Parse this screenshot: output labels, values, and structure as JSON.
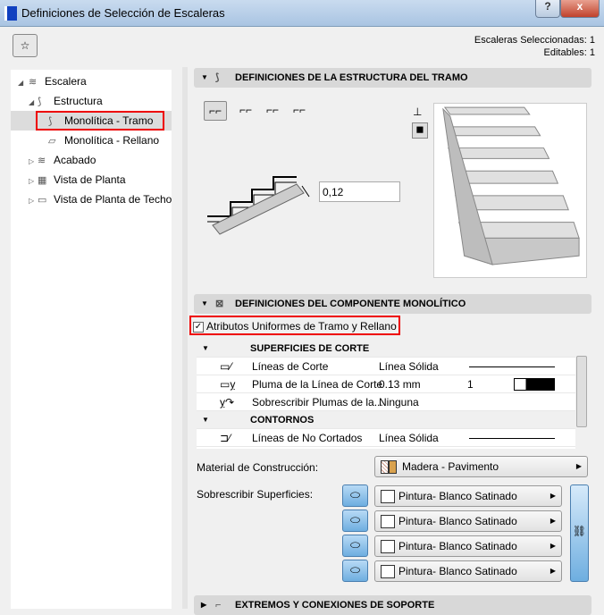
{
  "window": {
    "title": "Definiciones de Selección de Escaleras",
    "help": "?",
    "close": "x"
  },
  "info": {
    "selected": "Escaleras Seleccionadas: 1",
    "editable": "Editables: 1"
  },
  "tree": [
    {
      "label": "Escalera"
    },
    {
      "label": "Estructura"
    },
    {
      "label": "Monolítica - Tramo"
    },
    {
      "label": "Monolítica - Rellano"
    },
    {
      "label": "Acabado"
    },
    {
      "label": "Vista de Planta"
    },
    {
      "label": "Vista de Planta de Techo"
    }
  ],
  "sections": {
    "tramo": "DEFINICIONES DE LA ESTRUCTURA DEL TRAMO",
    "monolitico": "DEFINICIONES DEL COMPONENTE MONOLÍTICO",
    "extremos": "EXTREMOS Y CONEXIONES DE SOPORTE"
  },
  "tramo": {
    "thickness": "0,12"
  },
  "uniform": {
    "label": "Atributos Uniformes de Tramo y Rellano",
    "checked": true
  },
  "list": {
    "groups": [
      "SUPERFICIES DE CORTE",
      "CONTORNOS"
    ],
    "rows": [
      {
        "name": "Líneas de Corte",
        "value": "Línea Sólida",
        "num": ""
      },
      {
        "name": "Pluma de la Línea de Corte",
        "value": "0.13 mm",
        "num": "1"
      },
      {
        "name": "Sobrescribir Plumas de la...",
        "value": "Ninguna",
        "num": ""
      },
      {
        "name": "Líneas de No Cortados",
        "value": "Línea Sólida",
        "num": ""
      }
    ]
  },
  "material": {
    "label": "Material de Construcción:",
    "value": "Madera - Pavimento",
    "swatch": "#d9a24e"
  },
  "surfaces": {
    "label": "Sobrescribir Superficies:",
    "items": [
      "Pintura- Blanco Satinado",
      "Pintura- Blanco Satinado",
      "Pintura- Blanco Satinado",
      "Pintura- Blanco Satinado"
    ]
  }
}
